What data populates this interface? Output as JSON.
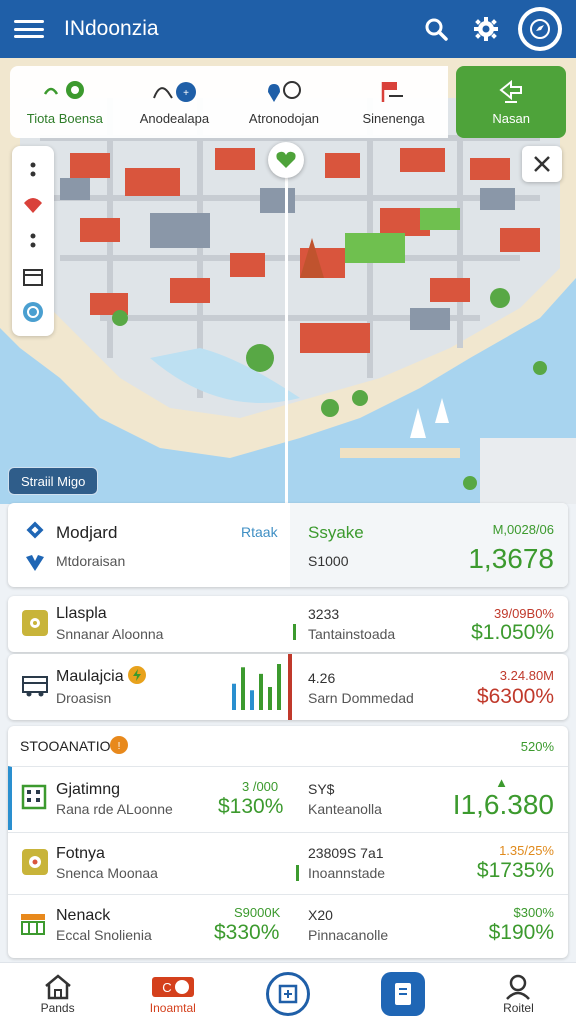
{
  "header": {
    "title": "INdoonzia",
    "menu_icon": "hamburger-icon",
    "search_icon": "search-icon",
    "settings_icon": "gear-icon",
    "profile_icon": "compass-icon",
    "color": "#1f5fa8"
  },
  "tabs": [
    {
      "label": "Tiota Boensa",
      "icon": "leaf-icon"
    },
    {
      "label": "Anodealapa",
      "icon": "balloon-icon"
    },
    {
      "label": "Atronodojan",
      "icon": "pin-icon"
    },
    {
      "label": "Sinenenga",
      "icon": "flag-icon"
    },
    {
      "label": "Nasan",
      "icon": "export-icon",
      "active": true
    }
  ],
  "map": {
    "tools": [
      "dots-icon",
      "red-pin-icon",
      "dots-icon",
      "layers-icon",
      "globe-icon"
    ],
    "close_icon": "close-icon",
    "pin_icon": "heart-pin-icon",
    "chip_label": "Straiil Migo"
  },
  "summary": {
    "name": "Modjard",
    "sub": "Mtdoraisan",
    "tag": "Rtaak",
    "right_title": "Ssyake",
    "right_sub": "S1000",
    "right_small": "M,0028/06",
    "right_big": "1,3678"
  },
  "rows1": [
    {
      "name": "Llaspla",
      "sub": "Snnanar Aloonna",
      "mid": "3233",
      "mid_sub": "Tantainstoada",
      "small": "39/09B0%",
      "big": "$1.050%",
      "icon": "sun-icon",
      "trend": "red"
    },
    {
      "name": "Maulajcia",
      "sub": "Droasisn",
      "mid": "4.26",
      "mid_sub": "Sarn Dommedad",
      "small": "3.24.80M",
      "big": "$6300%",
      "icon": "bus-icon",
      "trend": "red"
    }
  ],
  "section": {
    "title": "STOOANATIO",
    "badge_icon": "info-badge-icon",
    "value": "520%"
  },
  "rows2": [
    {
      "name": "Gjatimng",
      "sub": "Rana rde ALoonne",
      "pct_small": "3 /000",
      "pct_big": "$130%",
      "mid": "SY$",
      "mid_sub": "Kanteanolla",
      "small": "▲",
      "big": "I1,6.380",
      "icon": "building-icon"
    },
    {
      "name": "Fotnya",
      "sub": "Snenca Moonaa",
      "pct_small": "",
      "pct_big": "",
      "mid": "23809S 7a1",
      "mid_sub": "Inoannstade",
      "small": "1.35/25%",
      "big": "$1735%",
      "icon": "flower-icon"
    },
    {
      "name": "Nenack",
      "sub": "Eccal Snolienia",
      "pct_small": "S9000K",
      "pct_big": "$330%",
      "mid": "X20",
      "mid_sub": "Pinnacanolle",
      "small": "$300%",
      "big": "$190%",
      "icon": "market-icon"
    }
  ],
  "bottom_nav": [
    {
      "label": "Pands",
      "icon": "home-icon"
    },
    {
      "label": "Inoamtal",
      "icon": "cards-icon",
      "active": true
    },
    {
      "label": "",
      "icon": "map-circle-icon"
    },
    {
      "label": "",
      "icon": "tablet-icon"
    },
    {
      "label": "Roitel",
      "icon": "user-icon"
    }
  ],
  "chart_bars": [
    40,
    65,
    30,
    55,
    35,
    70
  ]
}
